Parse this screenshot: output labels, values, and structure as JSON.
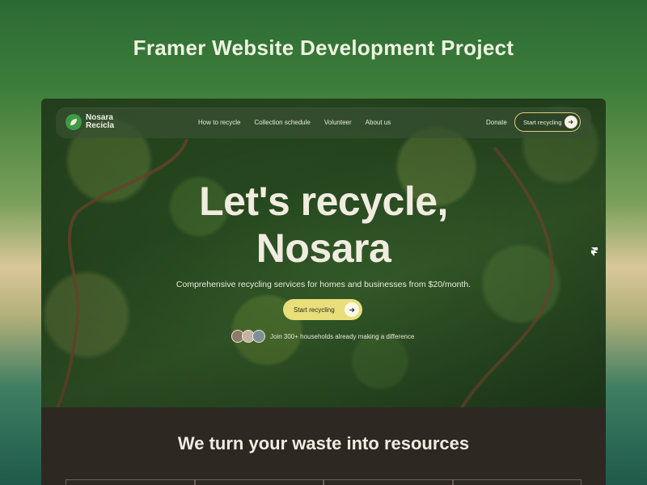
{
  "page": {
    "headline": "Framer Website Development Project"
  },
  "nav": {
    "logo_line1": "Nosara",
    "logo_line2": "Recicla",
    "links": [
      "How to recycle",
      "Collection schedule",
      "Volunteer",
      "About us"
    ],
    "donate": "Donate",
    "cta": "Start recycling"
  },
  "hero": {
    "title_line1": "Let's recycle,",
    "title_line2": "Nosara",
    "subtitle": "Comprehensive recycling services for homes and businesses from $20/month.",
    "cta": "Start recycling",
    "social_proof": "Join 300+ households already making a difference"
  },
  "section": {
    "title": "We turn your waste into resources"
  },
  "icons": [
    "logo-leaf-icon",
    "arrow-right-icon",
    "avatar",
    "framer-icon"
  ],
  "colors": {
    "accent": "#e8df7a",
    "logo_green": "#3f9a45",
    "dark_bg": "#2e2823"
  }
}
